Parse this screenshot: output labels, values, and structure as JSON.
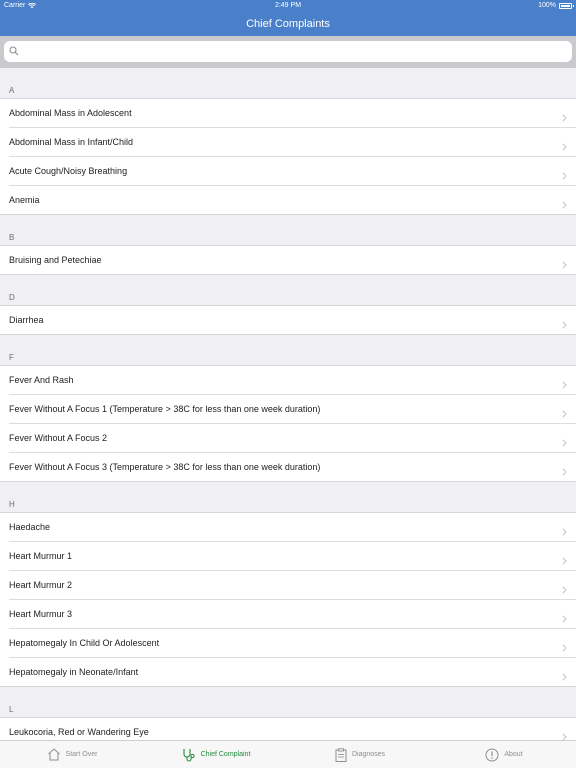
{
  "status": {
    "carrier": "Carrier",
    "time": "2:49 PM",
    "battery": "100%"
  },
  "nav": {
    "title": "Chief Complaints"
  },
  "search": {
    "placeholder": "",
    "value": ""
  },
  "sections": [
    {
      "letter": "A",
      "items": [
        "Abdominal Mass in Adolescent",
        "Abdominal Mass in Infant/Child",
        "Acute Cough/Noisy Breathing",
        "Anemia"
      ]
    },
    {
      "letter": "B",
      "items": [
        "Bruising and Petechiae"
      ]
    },
    {
      "letter": "D",
      "items": [
        "Diarrhea"
      ]
    },
    {
      "letter": "F",
      "items": [
        "Fever And Rash",
        "Fever Without A Focus 1 (Temperature > 38C for less than one week duration)",
        "Fever Without A Focus 2",
        "Fever Without A Focus 3 (Temperature > 38C for less than one week duration)"
      ]
    },
    {
      "letter": "H",
      "items": [
        "Haedache",
        "Heart Murmur 1",
        "Heart Murmur 2",
        "Heart Murmur 3",
        "Hepatomegaly In Child Or Adolescent",
        "Hepatomegaly in Neonate/Infant"
      ]
    },
    {
      "letter": "L",
      "items": [
        "Leukocoria, Red or Wandering Eye"
      ]
    }
  ],
  "tabs": {
    "start_over": "Start Over",
    "chief_complaint": "Chief Complaint",
    "diagnoses": "Diagnoses",
    "about": "About"
  },
  "colors": {
    "nav": "#4a7fc9",
    "active_tab": "#1f8a3a",
    "inactive_tab": "#8e8e93"
  },
  "icons": {
    "search": "search-icon",
    "chevron": "chevron-right-icon",
    "start_over": "home-icon",
    "chief_complaint": "stethoscope-icon",
    "diagnoses": "clipboard-icon",
    "about": "info-icon"
  }
}
